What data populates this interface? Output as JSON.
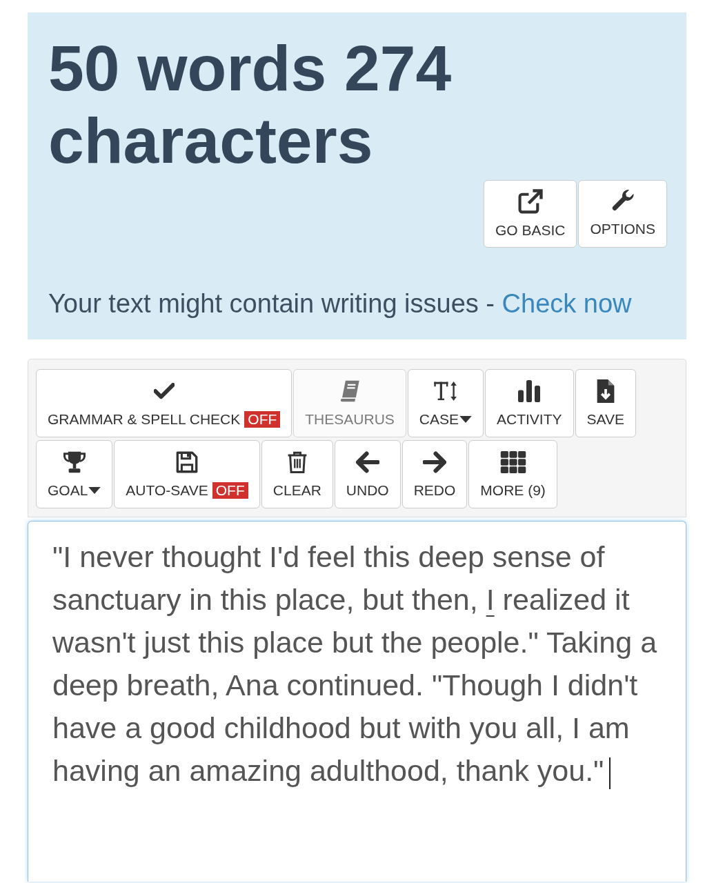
{
  "stats": {
    "title": "50 words 274 characters"
  },
  "header_buttons": [
    {
      "label": "GO BASIC"
    },
    {
      "label": "OPTIONS"
    }
  ],
  "notice": {
    "text": "Your text might contain writing issues - ",
    "link": "Check now"
  },
  "toolbar": {
    "buttons": [
      {
        "label": "GRAMMAR & SPELL CHECK",
        "badge": {
          "text": "OFF",
          "on": false
        },
        "disabled": false,
        "dropdown": false
      },
      {
        "label": "THESAURUS",
        "disabled": true,
        "dropdown": false
      },
      {
        "label": "CASE",
        "disabled": false,
        "dropdown": true
      },
      {
        "label": "ACTIVITY",
        "disabled": false,
        "dropdown": false
      },
      {
        "label": "SAVE",
        "disabled": false,
        "dropdown": false
      },
      {
        "label": "GOAL",
        "disabled": false,
        "dropdown": true
      },
      {
        "label": "AUTO-SAVE",
        "badge": {
          "text": "OFF",
          "on": false
        },
        "disabled": false,
        "dropdown": false
      },
      {
        "label": "CLEAR",
        "disabled": false,
        "dropdown": false
      },
      {
        "label": "UNDO",
        "disabled": false,
        "dropdown": false
      },
      {
        "label": "REDO",
        "disabled": false,
        "dropdown": false
      },
      {
        "label": "MORE (9)",
        "disabled": false,
        "dropdown": false
      }
    ]
  },
  "editor": {
    "segments": [
      {
        "text": "\"I never thought I'd feel this deep sense of sanctuary in this place, but then, ",
        "flagged": false
      },
      {
        "text": "I",
        "flagged": true
      },
      {
        "text": " realized it wasn't just this place but the people.\" Taking a deep breath, Ana continued. \"Though I didn't have a good childhood but with you all, I am having an amazing adulthood, thank you.\"",
        "flagged": false
      }
    ],
    "cursor": true
  }
}
